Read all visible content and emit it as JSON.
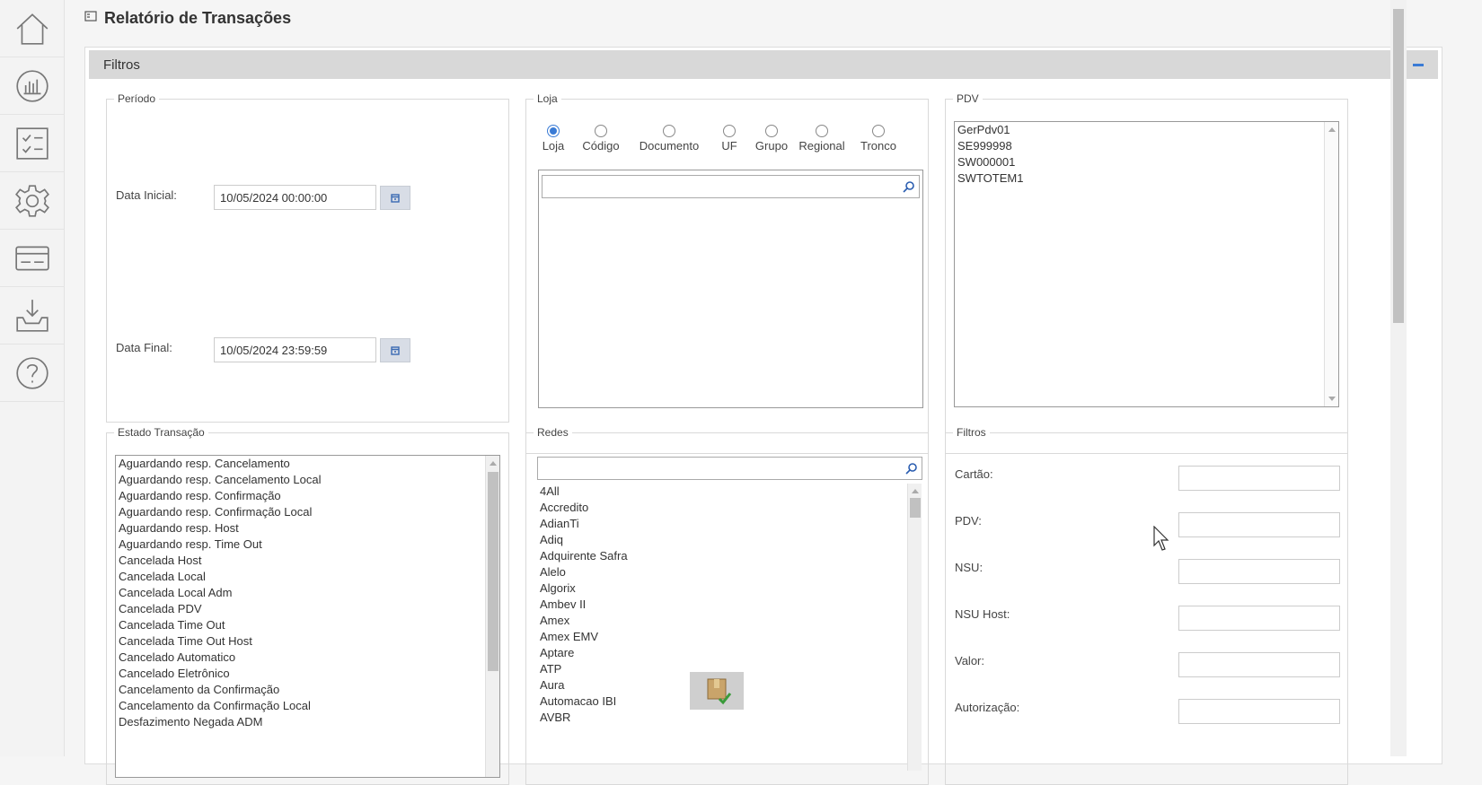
{
  "page": {
    "title": "Relatório de Transações"
  },
  "sidebar": {
    "items": [
      {
        "name": "home",
        "icon": "home-icon"
      },
      {
        "name": "reports",
        "icon": "chart-icon"
      },
      {
        "name": "tasks",
        "icon": "checklist-icon"
      },
      {
        "name": "settings",
        "icon": "gear-icon"
      },
      {
        "name": "cards",
        "icon": "card-icon"
      },
      {
        "name": "downloads",
        "icon": "inbox-download-icon"
      },
      {
        "name": "help",
        "icon": "help-icon"
      }
    ]
  },
  "filters_panel": {
    "title": "Filtros"
  },
  "periodo": {
    "legend": "Período",
    "data_inicial_label": "Data Inicial:",
    "data_inicial_value": "10/05/2024 00:00:00",
    "data_final_label": "Data Final:",
    "data_final_value": "10/05/2024 23:59:59"
  },
  "loja": {
    "legend": "Loja",
    "options": [
      "Loja",
      "Código",
      "Documento",
      "UF",
      "Grupo",
      "Regional",
      "Tronco"
    ],
    "selected": "Loja"
  },
  "pdv": {
    "legend": "PDV",
    "items": [
      "GerPdv01",
      "SE999998",
      "SW000001",
      "SWTOTEM1"
    ]
  },
  "estado": {
    "legend": "Estado Transação",
    "items": [
      "Aguardando resp. Cancelamento",
      "Aguardando resp. Cancelamento Local",
      "Aguardando resp. Confirmação",
      "Aguardando resp. Confirmação Local",
      "Aguardando resp. Host",
      "Aguardando resp. Time Out",
      "Cancelada Host",
      "Cancelada Local",
      "Cancelada Local Adm",
      "Cancelada PDV",
      "Cancelada Time Out",
      "Cancelada Time Out Host",
      "Cancelado Automatico",
      "Cancelado Eletrônico",
      "Cancelamento da Confirmação",
      "Cancelamento da Confirmação Local",
      "Desfazimento Negada ADM"
    ]
  },
  "redes": {
    "legend": "Redes",
    "items": [
      "4All",
      "Accredito",
      "AdianTi",
      "Adiq",
      "Adquirente Safra",
      "Alelo",
      "Algorix",
      "Ambev II",
      "Amex",
      "Amex EMV",
      "Aptare",
      "ATP",
      "Aura",
      "Automacao IBI",
      "AVBR"
    ]
  },
  "filtros": {
    "legend": "Filtros",
    "fields": [
      {
        "label": "Cartão:",
        "value": ""
      },
      {
        "label": "PDV:",
        "value": ""
      },
      {
        "label": "NSU:",
        "value": ""
      },
      {
        "label": "NSU Host:",
        "value": ""
      },
      {
        "label": "Valor:",
        "value": ""
      },
      {
        "label": "Autorização:",
        "value": ""
      }
    ]
  },
  "colors": {
    "accent": "#3a7bd5",
    "header_bg": "#d8d8d8"
  }
}
